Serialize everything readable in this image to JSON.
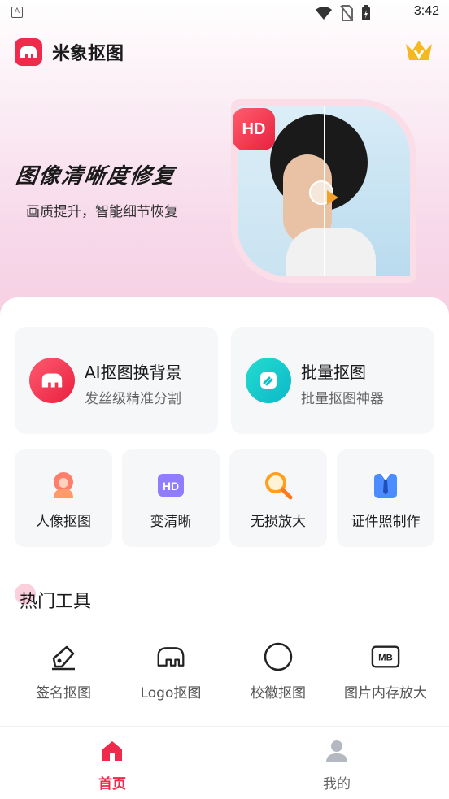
{
  "status_bar": {
    "time": "3:42",
    "notification_letter": "A"
  },
  "app": {
    "title": "米象抠图"
  },
  "banner": {
    "title": "图像清晰度修复",
    "subtitle": "画质提升，智能细节恢复",
    "badge": "HD"
  },
  "features_big": [
    {
      "title": "AI抠图换背景",
      "subtitle": "发丝级精准分割",
      "icon": "elephant-icon",
      "color": "#ef2a4a"
    },
    {
      "title": "批量抠图",
      "subtitle": "批量抠图神器",
      "icon": "batch-icon",
      "color": "#14c8c8"
    }
  ],
  "features_small": [
    {
      "label": "人像抠图",
      "icon": "portrait-icon"
    },
    {
      "label": "变清晰",
      "icon": "hd-icon"
    },
    {
      "label": "无损放大",
      "icon": "magnifier-icon"
    },
    {
      "label": "证件照制作",
      "icon": "id-photo-icon"
    }
  ],
  "hot_tools": {
    "title": "热门工具",
    "items": [
      {
        "label": "签名抠图",
        "icon": "pen-icon"
      },
      {
        "label": "Logo抠图",
        "icon": "elephant-outline-icon"
      },
      {
        "label": "校徽抠图",
        "icon": "badge-icon"
      },
      {
        "label": "图片内存放大",
        "icon": "mb-icon"
      }
    ]
  },
  "bottom_nav": [
    {
      "label": "首页",
      "icon": "home-icon",
      "active": true
    },
    {
      "label": "我的",
      "icon": "user-icon",
      "active": false
    }
  ],
  "colors": {
    "accent": "#ef2a4a",
    "inactive": "#666666"
  }
}
